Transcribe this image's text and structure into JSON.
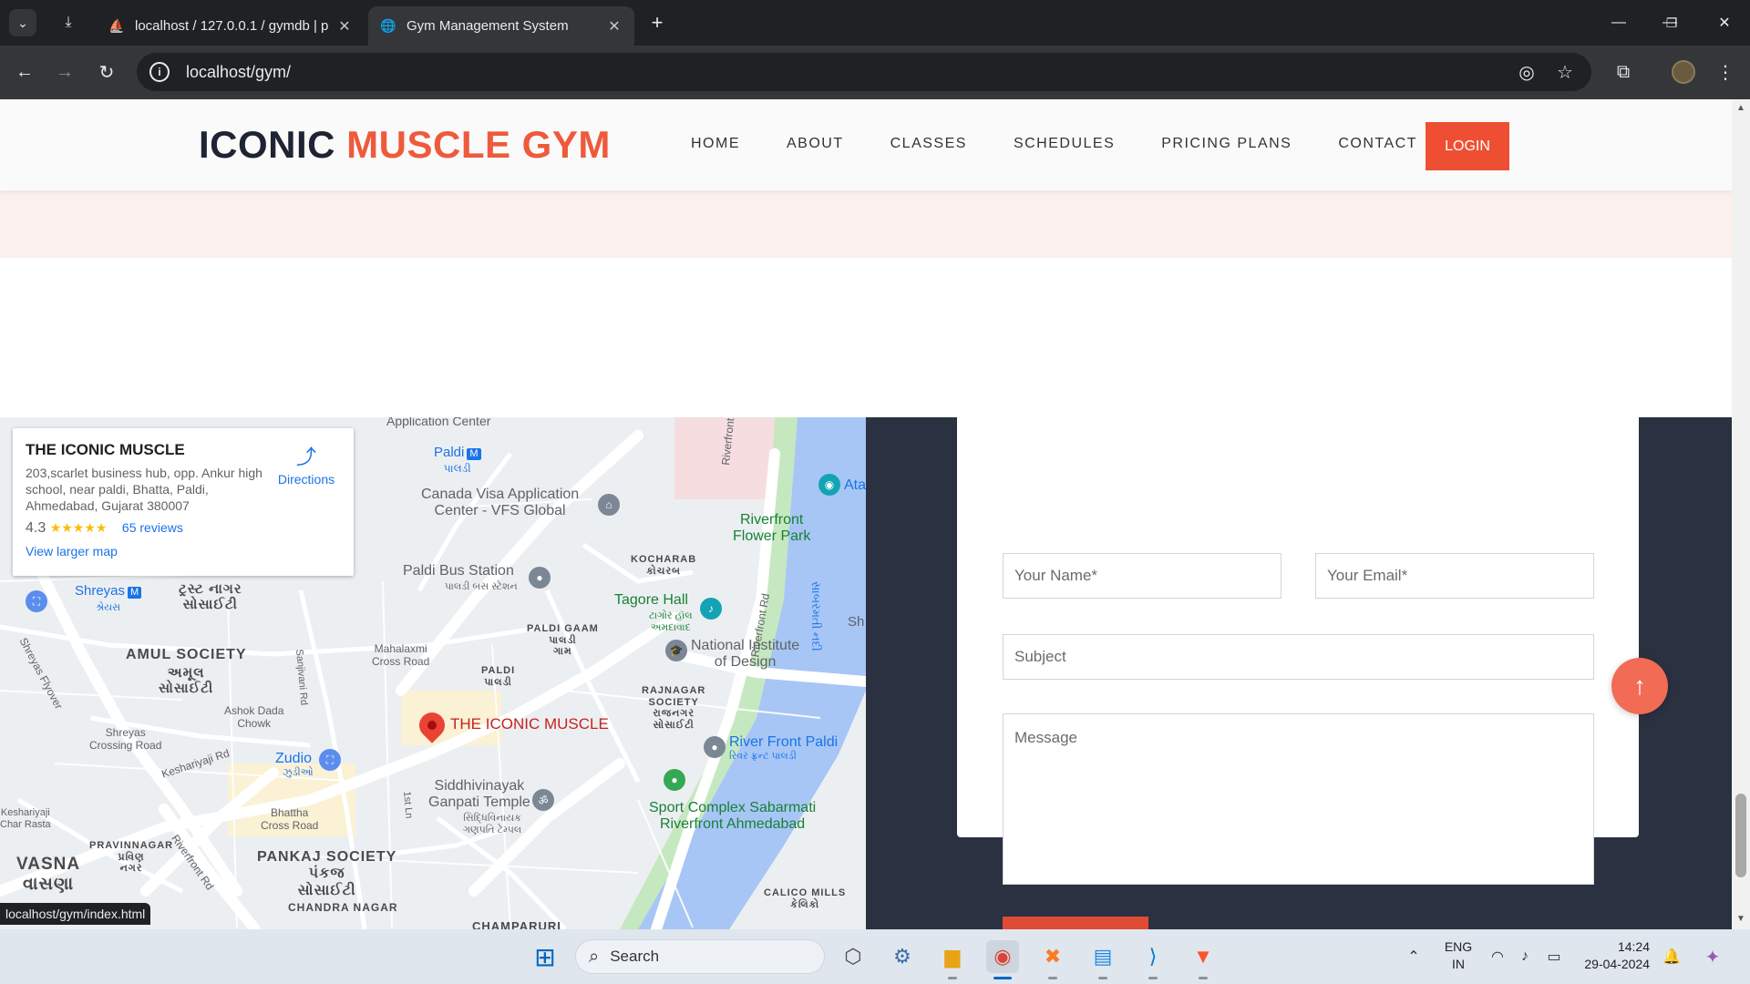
{
  "browser": {
    "tabs": [
      {
        "title": "localhost / 127.0.0.1 / gymdb | p",
        "active": false
      },
      {
        "title": "Gym Management System",
        "active": true
      }
    ],
    "url": "localhost/gym/",
    "status_url": "localhost/gym/index.html"
  },
  "site": {
    "logo_dark": "ICONIC",
    "logo_accent": "MUSCLE GYM",
    "nav": [
      "HOME",
      "ABOUT",
      "CLASSES",
      "SCHEDULES",
      "PRICING PLANS",
      "CONTACT"
    ],
    "login_label": "LOGIN",
    "colors": {
      "accent": "#ee4f33",
      "dark": "#1e2433",
      "contact_bg": "#2a3140"
    }
  },
  "map": {
    "card": {
      "place": "THE ICONIC MUSCLE",
      "address": "203,scarlet business hub, opp. Ankur high school, near paldi, Bhatta, Paldi, Ahmedabad, Gujarat 380007",
      "rating": "4.3",
      "stars": "★★★★★",
      "reviews": "65 reviews",
      "larger_map": "View larger map",
      "directions": "Directions"
    },
    "labels": {
      "application_center": "Application Center",
      "paldi": "Paldi",
      "paldi_guj": "પાલડી",
      "canada_visa": "Canada Visa Application\nCenter - VFS Global",
      "paldi_bus": "Paldi Bus Station",
      "paldi_bus_guj": "પાલડી બસ સ્ટેશન",
      "kocharab": "KOCHARAB\nકોચરબ",
      "riverfront_flower": "Riverfront\nFlower Park",
      "ata": "Ata",
      "tagore_hall": "Tagore Hall",
      "tagore_guj": "ટાગોર હૉલ\nઅમદાવાદ",
      "sh": "Sh",
      "shreyas": "Shreyas",
      "shreyas_guj": "શ્રેયસ",
      "trust_nagar": "ટ્રસ્ટ નાગર\nસોસાઈટી",
      "amul_society": "AMUL SOCIETY",
      "amul_guj": "અમૂલ\nસોસાઈટી",
      "mahalaxmi": "Mahalaxmi\nCross Road",
      "paldi_gaam": "PALDI GAAM\nપાલડી\nગામ",
      "paldi_caps": "PALDI\nપાલડી",
      "nid": "National Institute\nof Design",
      "rajnagar": "RAJNAGAR\nSOCIETY\nરાજનગર\nસોસાઈટી",
      "ashok_dada": "Ashok Dada\nChowk",
      "shreyas_crossing": "Shreyas\nCrossing Road",
      "keshariyaji_rd": "Keshariyaji Rd",
      "gym_pin": "THE ICONIC MUSCLE",
      "river_front_paldi": "River Front Paldi",
      "river_front_paldi_guj": "રિવર ફ્રન્ટ પાલડી",
      "zudio": "Zudio",
      "zudio_guj": "ઝુડીઓ",
      "siddhivinayak": "Siddhivinayak\nGanpati Temple",
      "siddhivinayak_guj": "સિદ્ધિવિનાયક\nગણપતિ ટેમ્પલ",
      "sport_complex": "Sport Complex Sabarmati\nRiverfront Ahmedabad",
      "bhattha": "Bhattha\nCross Road",
      "keshariyaji_char": "Keshariyaji\nChar Rasta",
      "pravinnagar": "PRAVINNAGAR\nપ્રવિણ\nનગર",
      "vasna": "VASNA\nવાસણા",
      "pankaj": "PANKAJ SOCIETY\nપંકજ\nસોસાઈટી",
      "chandra_nagar": "CHANDRA NAGAR",
      "champaruri": "CHAMPARURI",
      "calico": "CALICO MILLS\nકેલિકો",
      "riverfront_rd": "Riverfront Rd",
      "shreyas_flyover": "Shreyas Flyover",
      "sanjivani_rd": "Sanjivani Rd",
      "first_ln": "1st Ln",
      "sabarmati_guj": "સાબરમતી નદી"
    }
  },
  "contact_form": {
    "name_placeholder": "Your Name*",
    "email_placeholder": "Your Email*",
    "subject_placeholder": "Subject",
    "message_placeholder": "Message"
  },
  "taskbar": {
    "search_label": "Search",
    "lang": "ENG\nIN",
    "time": "14:24",
    "date": "29-04-2024"
  }
}
